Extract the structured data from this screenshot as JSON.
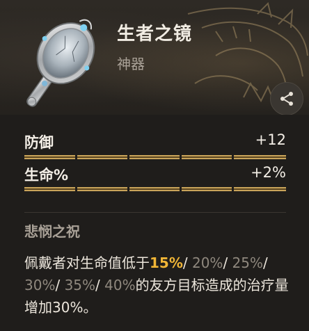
{
  "item": {
    "name": "生者之镜",
    "type": "神器",
    "icon": "hand-mirror-icon"
  },
  "share": {
    "icon": "share-icon"
  },
  "stats": [
    {
      "label": "防御",
      "value": "+12"
    },
    {
      "label": "生命%",
      "value": "+2%"
    }
  ],
  "ability": {
    "title": "悲悯之祝",
    "desc_prefix": "佩戴者对生命值低于",
    "tier_current": "15%",
    "sep": "/ ",
    "tiers_other": [
      "20%",
      "25%",
      "30%",
      "35%",
      "40%"
    ],
    "desc_suffix": "的友方目标造成的治疗量增加30%。"
  },
  "colors": {
    "highlight": "#f0b536",
    "dim": "#8f887e",
    "gold_bar": "#c9a45a"
  }
}
